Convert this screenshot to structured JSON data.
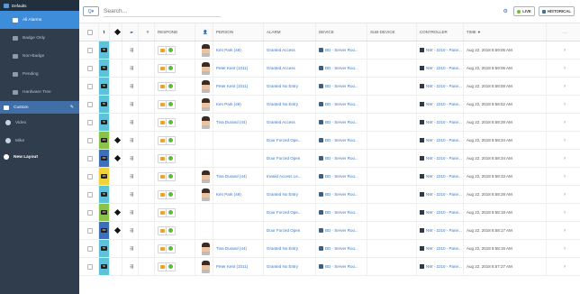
{
  "sidebar": {
    "header": "Defaults",
    "items": [
      {
        "label": "All Alarms",
        "active": true
      },
      {
        "label": "Badge Only"
      },
      {
        "label": "Non-Badge"
      },
      {
        "label": "Pending"
      },
      {
        "label": "Hardware Tree"
      }
    ],
    "custom_label": "Custom",
    "custom_items": [
      {
        "label": "Video"
      },
      {
        "label": "Mike"
      }
    ],
    "new_layout": "New Layout"
  },
  "search": {
    "placeholder": "Search..."
  },
  "toolbar": {
    "live_label": "LIVE",
    "history_label": "HISTORICAL"
  },
  "columns": {
    "respond": "RESPOND",
    "person": "PERSON",
    "alarm": "ALARM",
    "device": "DEVICE",
    "subdevice": "SUB-DEVICE",
    "controller": "CONTROLLER",
    "time": "TIME",
    "more": "..."
  },
  "rows": [
    {
      "pri": "50",
      "pri_color": "#5ec3d8",
      "person": "Ken Park (49)",
      "alarm": "Granted Access",
      "device": "BD - Server Roo...",
      "controller": "NW - 2210 - Pane...",
      "time": "Aug 22, 2018 8:59:06 AM",
      "avatar": true
    },
    {
      "pri": "50",
      "pri_color": "#5ec3d8",
      "person": "Peter Kent (1011)",
      "alarm": "Granted Access",
      "device": "BD - Server Roo...",
      "controller": "NW - 2210 - Pane...",
      "time": "Aug 22, 2018 8:59:06 AM",
      "avatar": true
    },
    {
      "pri": "50",
      "pri_color": "#5ec3d8",
      "person": "Peter Kent (1011)",
      "alarm": "Granted No Entry",
      "device": "BD - Server Roo...",
      "controller": "NW - 2210 - Pane...",
      "time": "Aug 22, 2018 8:58:59 AM",
      "avatar": true
    },
    {
      "pri": "50",
      "pri_color": "#5ec3d8",
      "person": "Ken Park (49)",
      "alarm": "Granted No Entry",
      "device": "BD - Server Roo...",
      "controller": "NW - 2210 - Pane...",
      "time": "Aug 22, 2018 8:58:52 AM",
      "avatar": true
    },
    {
      "pri": "50",
      "pri_color": "#5ec3d8",
      "person": "Tina Durand (44)",
      "alarm": "Granted Access",
      "device": "BD - Server Roo...",
      "controller": "NW - 2210 - Pane...",
      "time": "Aug 22, 2018 8:58:39 AM",
      "avatar": true
    },
    {
      "pri": "100",
      "pri_color": "#8bc34a",
      "person": "",
      "alarm": "Door Forced Ope...",
      "device": "BD - Server Roo...",
      "controller": "NW - 2210 - Pane...",
      "time": "Aug 22, 2018 8:58:34 AM",
      "avatar": false,
      "diamond": true
    },
    {
      "pri": "250",
      "pri_color": "#3e6fb8",
      "person": "",
      "alarm": "Door Forced Open",
      "device": "BD - Server Roo...",
      "controller": "NW - 2210 - Pane...",
      "time": "Aug 22, 2018 8:58:34 AM",
      "avatar": false,
      "diamond": true
    },
    {
      "pri": "150",
      "pri_color": "#f2d23b",
      "person": "Tina Durand (44)",
      "alarm": "Invalid Access Le...",
      "device": "BD - Server Roo...",
      "controller": "NW - 2210 - Pane...",
      "time": "Aug 22, 2018 8:58:33 AM",
      "avatar": true
    },
    {
      "pri": "50",
      "pri_color": "#5ec3d8",
      "person": "Ken Park (49)",
      "alarm": "Granted No Entry",
      "device": "BD - Server Roo...",
      "controller": "NW - 2210 - Pane...",
      "time": "Aug 22, 2018 8:58:28 AM",
      "avatar": true
    },
    {
      "pri": "100",
      "pri_color": "#8bc34a",
      "person": "",
      "alarm": "Door Forced Ope...",
      "device": "BD - Server Roo...",
      "controller": "NW - 2210 - Pane...",
      "time": "Aug 22, 2018 8:58:18 AM",
      "avatar": false,
      "diamond": true
    },
    {
      "pri": "250",
      "pri_color": "#3e6fb8",
      "person": "",
      "alarm": "Door Forced Open",
      "device": "BD - Server Roo...",
      "controller": "NW - 2210 - Pane...",
      "time": "Aug 22, 2018 8:58:17 AM",
      "avatar": false,
      "diamond": true
    },
    {
      "pri": "50",
      "pri_color": "#5ec3d8",
      "person": "Tina Durand (44)",
      "alarm": "Granted No Entry",
      "device": "BD - Server Roo...",
      "controller": "NW - 2210 - Pane...",
      "time": "Aug 22, 2018 8:58:16 AM",
      "avatar": true
    },
    {
      "pri": "50",
      "pri_color": "#5ec3d8",
      "person": "Peter Kent (1011)",
      "alarm": "Granted No Entry",
      "device": "BD - Server Roo...",
      "controller": "NW - 2210 - Pane...",
      "time": "Aug 22, 2018 8:57:27 AM",
      "avatar": true
    }
  ]
}
